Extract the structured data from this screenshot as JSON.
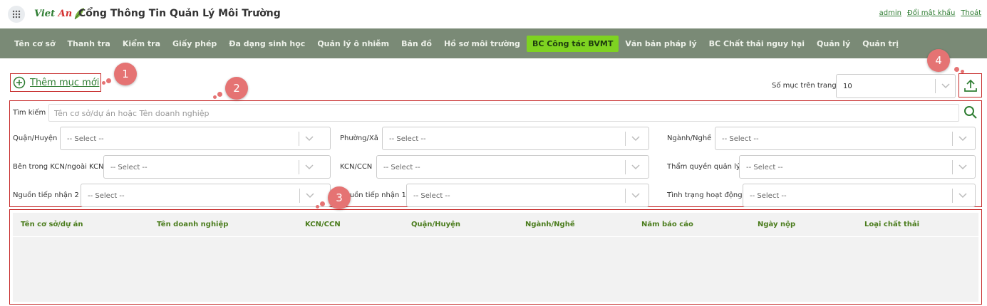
{
  "header": {
    "logo_text_main": "Viet",
    "logo_text_accent": "An",
    "title": "Cổng Thông Tin Quản Lý Môi Trường",
    "links": [
      "admin",
      "Đổi mật khẩu",
      "Thoát"
    ]
  },
  "nav": {
    "items": [
      "Tên cơ sở",
      "Thanh tra",
      "Kiểm tra",
      "Giấy phép",
      "Đa dạng sinh học",
      "Quản lý ô nhiễm",
      "Bản đồ",
      "Hồ sơ môi trường",
      "BC Công tác BVMT",
      "Văn bản pháp lý",
      "BC Chất thải nguy hại",
      "Quản lý",
      "Quản trị"
    ],
    "active_index": 8
  },
  "toolbar": {
    "add_label": "Thêm mục mới",
    "page_size_label": "Số mục trên trang",
    "page_size_value": "10"
  },
  "callouts": [
    "1",
    "2",
    "3",
    "4"
  ],
  "search": {
    "label": "Tìm kiếm",
    "placeholder": "Tên cơ sở/dự án hoặc Tên doanh nghiệp"
  },
  "filters": {
    "quan_huyen": {
      "label": "Quận/Huyện",
      "value": "-- Select --"
    },
    "phuong_xa": {
      "label": "Phường/Xã",
      "value": "-- Select --"
    },
    "nganh_nghe": {
      "label": "Ngành/Nghề",
      "value": "-- Select --"
    },
    "ben_trong_kcn": {
      "label": "Bên trong KCN/ngoài KCN",
      "value": "-- Select --"
    },
    "kcn_ccn": {
      "label": "KCN/CCN",
      "value": "-- Select --"
    },
    "tham_quyen": {
      "label": "Thẩm quyền quản lý",
      "value": "-- Select --"
    },
    "nguon_2": {
      "label": "Nguồn tiếp nhận 2",
      "value": "-- Select --"
    },
    "nguon_1": {
      "label": "Nguồn tiếp nhận 1",
      "value": "-- Select --"
    },
    "tinh_trang": {
      "label": "Tình trạng hoạt động",
      "value": "-- Select --"
    }
  },
  "table": {
    "columns": [
      "Tên cơ sở/dự án",
      "Tên doanh nghiệp",
      "KCN/CCN",
      "Quận/Huyện",
      "Ngành/Nghề",
      "Năm báo cáo",
      "Ngày nộp",
      "Loại chất thải"
    ]
  },
  "colors": {
    "brand_green": "#2e7d32",
    "nav_bg": "#7a8a76",
    "nav_active": "#7ed321",
    "highlight_red": "#c62828",
    "callout": "#e57373"
  },
  "icons": [
    "apps-grid-icon",
    "leaf-logo-icon",
    "plus-circle-icon",
    "chevron-down-icon",
    "upload-icon",
    "search-icon"
  ]
}
